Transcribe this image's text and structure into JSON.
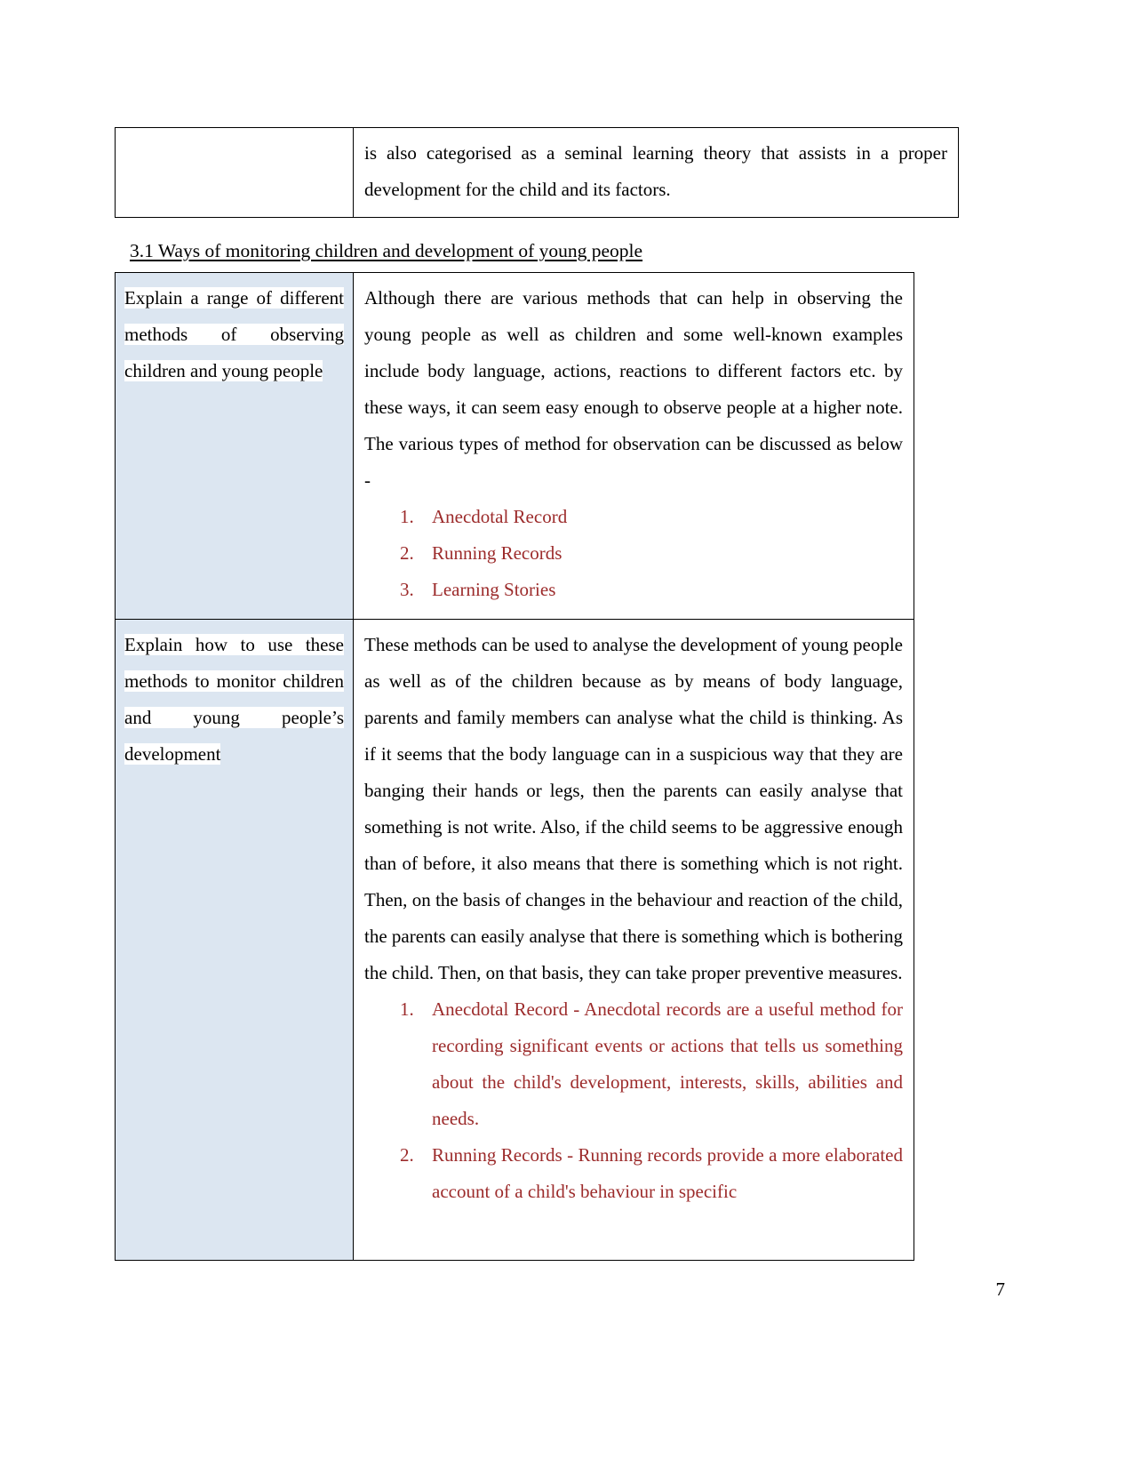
{
  "page": {
    "number": "7"
  },
  "continued_table": {
    "left_cell": "",
    "right_cell": "is also categorised as a seminal learning theory that assists in a proper development for the child and its factors."
  },
  "heading": "3.1 Ways of monitoring children and development of young people",
  "main_table": {
    "rows": [
      {
        "prompt": "Explain a range of different methods of observing children and young people",
        "body": "Although there are various methods that can help in observing the young people as well as children and some well-known examples include body language, actions, reactions to different factors etc. by these ways, it can seem easy enough to observe people at a higher note. The various types of method for observation can be discussed as below -",
        "list": [
          "Anecdotal Record",
          "Running Records",
          "Learning Stories"
        ]
      },
      {
        "prompt": "Explain how to use these methods to monitor children and young people’s development",
        "body": "These methods can be used to analyse the development of young people as well as of the children because as by means of body language, parents and family members can analyse what the child is thinking. As if it seems that the body language can in a suspicious way that they are banging their hands or legs, then the parents can easily analyse that something is not write. Also, if the child seems to be aggressive enough than of before, it also means that there is something which is not right. Then, on the basis of changes in the behaviour and reaction of the child, the parents can easily analyse that there is something which is bothering the child. Then, on that basis, they can take proper preventive measures.",
        "list": [
          "Anecdotal Record - Anecdotal records are a useful method for recording significant events or actions that tells us something about the child's development, interests, skills, abilities and needs.",
          "Running Records - Running records provide a more elaborated account of a child's behaviour in specific"
        ]
      }
    ]
  },
  "colors": {
    "list_text": "#9c2b2b",
    "left_cell_background": "#dce6f1",
    "body_text": "#000000",
    "page_background": "#ffffff"
  }
}
